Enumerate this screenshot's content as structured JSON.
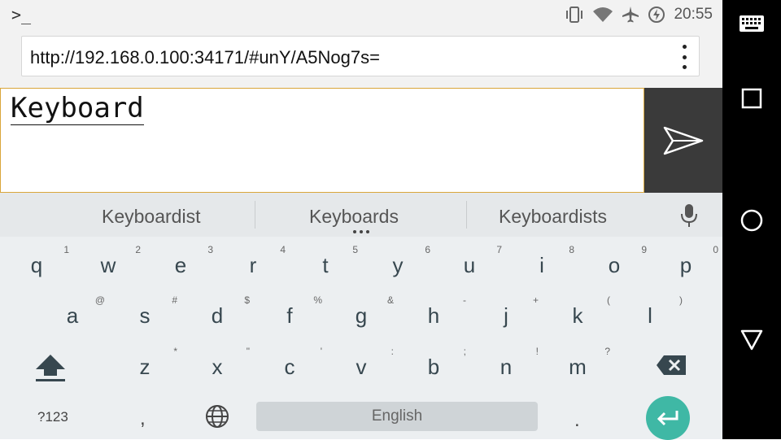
{
  "status_bar": {
    "time": "20:55",
    "icons": [
      "terminal-icon",
      "vibrate-icon",
      "wifi-icon",
      "airplane-icon",
      "battery-saver-icon"
    ]
  },
  "browser": {
    "url": "http://192.168.0.100:34171/#unY/A5Nog7s=",
    "menu_icon": "more-vert-icon"
  },
  "editor": {
    "text": "Keyboard",
    "send_icon": "send-icon"
  },
  "keyboard": {
    "suggestions": [
      "Keyboardist",
      "Keyboards",
      "Keyboardists"
    ],
    "row1": [
      {
        "key": "q",
        "hint": "1"
      },
      {
        "key": "w",
        "hint": "2"
      },
      {
        "key": "e",
        "hint": "3"
      },
      {
        "key": "r",
        "hint": "4"
      },
      {
        "key": "t",
        "hint": "5"
      },
      {
        "key": "y",
        "hint": "6"
      },
      {
        "key": "u",
        "hint": "7"
      },
      {
        "key": "i",
        "hint": "8"
      },
      {
        "key": "o",
        "hint": "9"
      },
      {
        "key": "p",
        "hint": "0"
      }
    ],
    "row2": [
      {
        "key": "a",
        "hint": "@"
      },
      {
        "key": "s",
        "hint": "#"
      },
      {
        "key": "d",
        "hint": "$"
      },
      {
        "key": "f",
        "hint": "%"
      },
      {
        "key": "g",
        "hint": "&"
      },
      {
        "key": "h",
        "hint": "-"
      },
      {
        "key": "j",
        "hint": "+"
      },
      {
        "key": "k",
        "hint": "("
      },
      {
        "key": "l",
        "hint": ")"
      }
    ],
    "row3": [
      {
        "key": "z",
        "hint": "*"
      },
      {
        "key": "x",
        "hint": "\""
      },
      {
        "key": "c",
        "hint": "'"
      },
      {
        "key": "v",
        "hint": ":"
      },
      {
        "key": "b",
        "hint": ";"
      },
      {
        "key": "n",
        "hint": "!"
      },
      {
        "key": "m",
        "hint": "?"
      }
    ],
    "symbols_label": "?123",
    "comma": ",",
    "period": ".",
    "space_label": "English",
    "accent_color": "#3fb8a5"
  },
  "nav_bar": {
    "icons": [
      "keyboard-icon",
      "recents-icon",
      "home-icon",
      "back-icon"
    ]
  }
}
